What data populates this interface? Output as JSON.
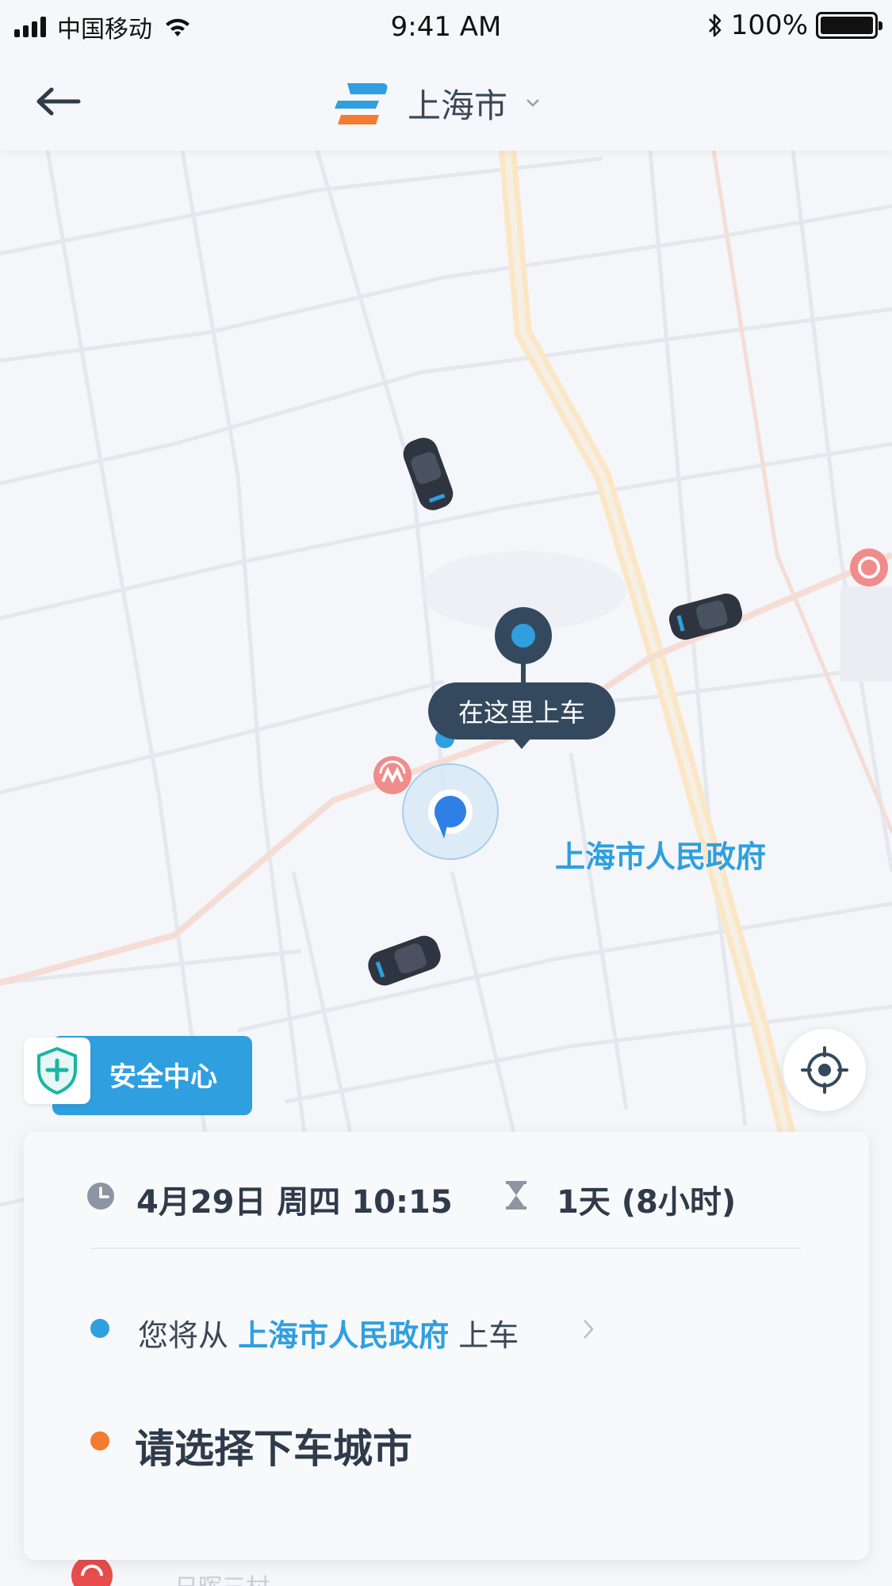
{
  "status_bar": {
    "carrier": "中国移动",
    "time": "9:41 AM",
    "battery_percent": "100%"
  },
  "header": {
    "city": "上海市",
    "back_icon": "back-arrow-icon",
    "logo_icon": "brand-logo-icon",
    "dropdown_icon": "chevron-down-icon"
  },
  "map": {
    "pickup_bubble": "在这里上车",
    "place_label": "上海市人民政府",
    "cars_visible": 3,
    "metro_icons": 2
  },
  "safety_center": {
    "label": "安全中心",
    "icon": "shield-plus-icon"
  },
  "card": {
    "datetime": "4月29日 周四 10:15",
    "duration": "1天 (8小时)",
    "pickup_prefix": "您将从",
    "pickup_place": "上海市人民政府",
    "pickup_suffix": "上车",
    "dropoff_prompt": "请选择下车城市"
  },
  "bottom_partial_text": "日晖三村",
  "colors": {
    "accent_blue": "#2f9fe0",
    "dark_slate": "#34495e",
    "orange": "#f47b31",
    "road_highlight": "#fbe7c6"
  }
}
